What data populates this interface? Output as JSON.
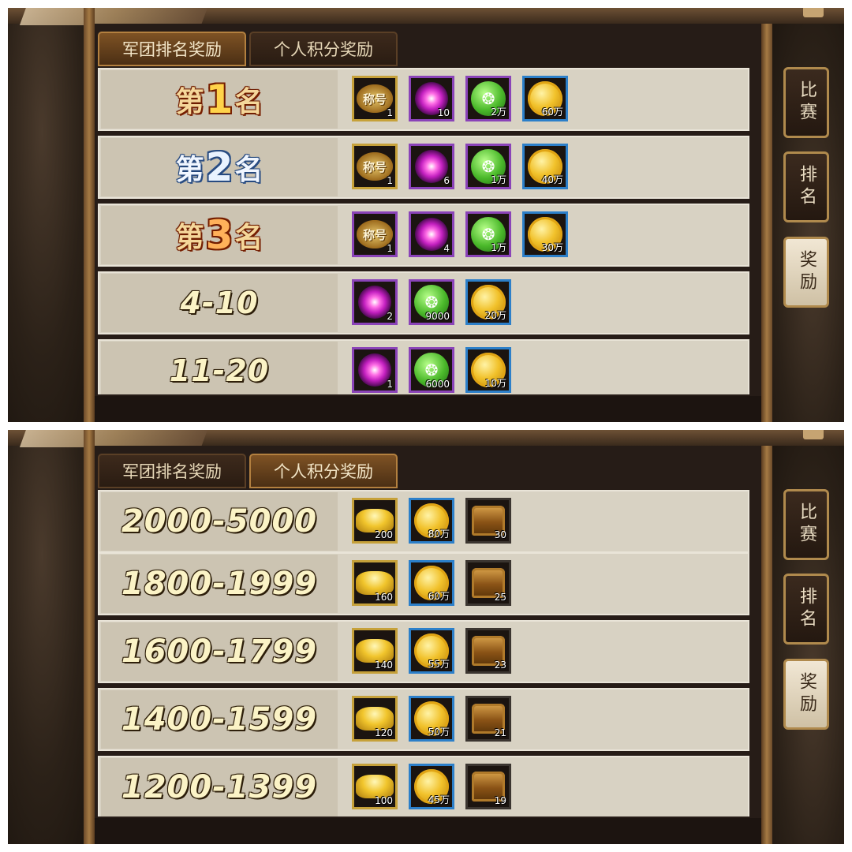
{
  "top": {
    "tabs": [
      {
        "label": "军团排名奖励",
        "active": true
      },
      {
        "label": "个人积分奖励",
        "active": false
      }
    ],
    "rows": [
      {
        "rank_ch1": "第",
        "rank_num": "1",
        "rank_ch2": "名",
        "items": [
          {
            "icon": "title-badge-icon",
            "label": "称号",
            "qty": "1"
          },
          {
            "icon": "purple-orb-icon",
            "qty": "10"
          },
          {
            "icon": "green-paw-icon",
            "qty": "2万"
          },
          {
            "icon": "gold-coin-icon",
            "qty": "60万"
          }
        ]
      },
      {
        "rank_ch1": "第",
        "rank_num": "2",
        "rank_ch2": "名",
        "items": [
          {
            "icon": "title-badge-icon",
            "label": "称号",
            "qty": "1"
          },
          {
            "icon": "purple-orb-icon",
            "qty": "6"
          },
          {
            "icon": "green-paw-icon",
            "qty": "1万"
          },
          {
            "icon": "gold-coin-icon",
            "qty": "40万"
          }
        ]
      },
      {
        "rank_ch1": "第",
        "rank_num": "3",
        "rank_ch2": "名",
        "items": [
          {
            "icon": "title-badge-icon",
            "label": "称号",
            "qty": "1"
          },
          {
            "icon": "purple-orb-icon",
            "qty": "4"
          },
          {
            "icon": "green-paw-icon",
            "qty": "1万"
          },
          {
            "icon": "gold-coin-icon",
            "qty": "30万"
          }
        ]
      },
      {
        "rank": "4-10",
        "items": [
          {
            "icon": "purple-orb-icon",
            "qty": "2"
          },
          {
            "icon": "green-paw-icon",
            "qty": "9000"
          },
          {
            "icon": "gold-coin-icon",
            "qty": "20万"
          }
        ]
      },
      {
        "rank": "11-20",
        "items": [
          {
            "icon": "purple-orb-icon",
            "qty": "1"
          },
          {
            "icon": "green-paw-icon",
            "qty": "6000"
          },
          {
            "icon": "gold-coin-icon",
            "qty": "10万"
          }
        ]
      }
    ],
    "side": [
      "比赛",
      "排名",
      "奖励"
    ]
  },
  "bottom": {
    "tabs": [
      {
        "label": "军团排名奖励",
        "active": false
      },
      {
        "label": "个人积分奖励",
        "active": true
      }
    ],
    "rows": [
      {
        "rank": "2000-5000",
        "items": [
          {
            "icon": "gold-ingot-icon",
            "qty": "200"
          },
          {
            "icon": "gold-coin-icon",
            "qty": "80万"
          },
          {
            "icon": "treasure-chest-icon",
            "qty": "30"
          }
        ]
      },
      {
        "rank": "1800-1999",
        "items": [
          {
            "icon": "gold-ingot-icon",
            "qty": "160"
          },
          {
            "icon": "gold-coin-icon",
            "qty": "60万"
          },
          {
            "icon": "treasure-chest-icon",
            "qty": "25"
          }
        ]
      },
      {
        "rank": "1600-1799",
        "items": [
          {
            "icon": "gold-ingot-icon",
            "qty": "140"
          },
          {
            "icon": "gold-coin-icon",
            "qty": "55万"
          },
          {
            "icon": "treasure-chest-icon",
            "qty": "23"
          }
        ]
      },
      {
        "rank": "1400-1599",
        "items": [
          {
            "icon": "gold-ingot-icon",
            "qty": "120"
          },
          {
            "icon": "gold-coin-icon",
            "qty": "50万"
          },
          {
            "icon": "treasure-chest-icon",
            "qty": "21"
          }
        ]
      },
      {
        "rank": "1200-1399",
        "items": [
          {
            "icon": "gold-ingot-icon",
            "qty": "100"
          },
          {
            "icon": "gold-coin-icon",
            "qty": "45万"
          },
          {
            "icon": "treasure-chest-icon",
            "qty": "19"
          }
        ]
      }
    ],
    "side": [
      "比赛",
      "排名",
      "奖励"
    ]
  },
  "colors": {
    "accent": "#b3803f",
    "row_bg": "#d8d2c3",
    "dark_bg": "#261c17"
  }
}
